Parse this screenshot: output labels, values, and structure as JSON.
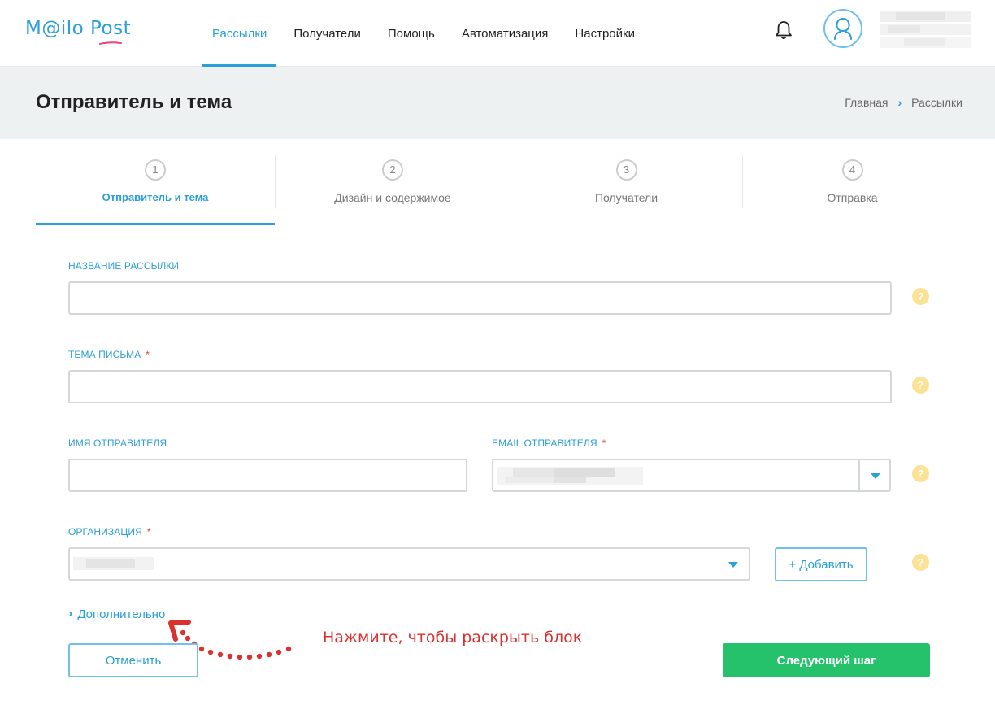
{
  "header": {
    "logo": "M@ilo Post",
    "nav": [
      {
        "label": "Рассылки",
        "active": true
      },
      {
        "label": "Получатели",
        "active": false
      },
      {
        "label": "Помощь",
        "active": false
      },
      {
        "label": "Автоматизация",
        "active": false
      },
      {
        "label": "Настройки",
        "active": false
      }
    ]
  },
  "page": {
    "title": "Отправитель и тема",
    "breadcrumb": [
      "Главная",
      "Рассылки"
    ]
  },
  "steps": [
    {
      "num": "1",
      "label": "Отправитель и тема",
      "active": true
    },
    {
      "num": "2",
      "label": "Дизайн и содержимое",
      "active": false
    },
    {
      "num": "3",
      "label": "Получатели",
      "active": false
    },
    {
      "num": "4",
      "label": "Отправка",
      "active": false
    }
  ],
  "form": {
    "campaign_name": {
      "label": "Название рассылки",
      "value": ""
    },
    "subject": {
      "label": "Тема письма",
      "required": "*",
      "value": ""
    },
    "sender_name": {
      "label": "Имя отправителя",
      "value": ""
    },
    "sender_email": {
      "label": "Email отправителя",
      "required": "*"
    },
    "organization": {
      "label": "Организация",
      "required": "*"
    },
    "help_glyph": "?",
    "add_button": "+ Добавить",
    "more_link": "Дополнительно",
    "more_chevron": "›",
    "cancel_button": "Отменить",
    "next_button": "Следующий шаг"
  },
  "annotation": "Нажмите, чтобы раскрыть блок",
  "colors": {
    "accent": "#2a9fd8",
    "primary_button": "#26c26b",
    "help_icon": "#fbe295",
    "annotation": "#d9312f"
  }
}
